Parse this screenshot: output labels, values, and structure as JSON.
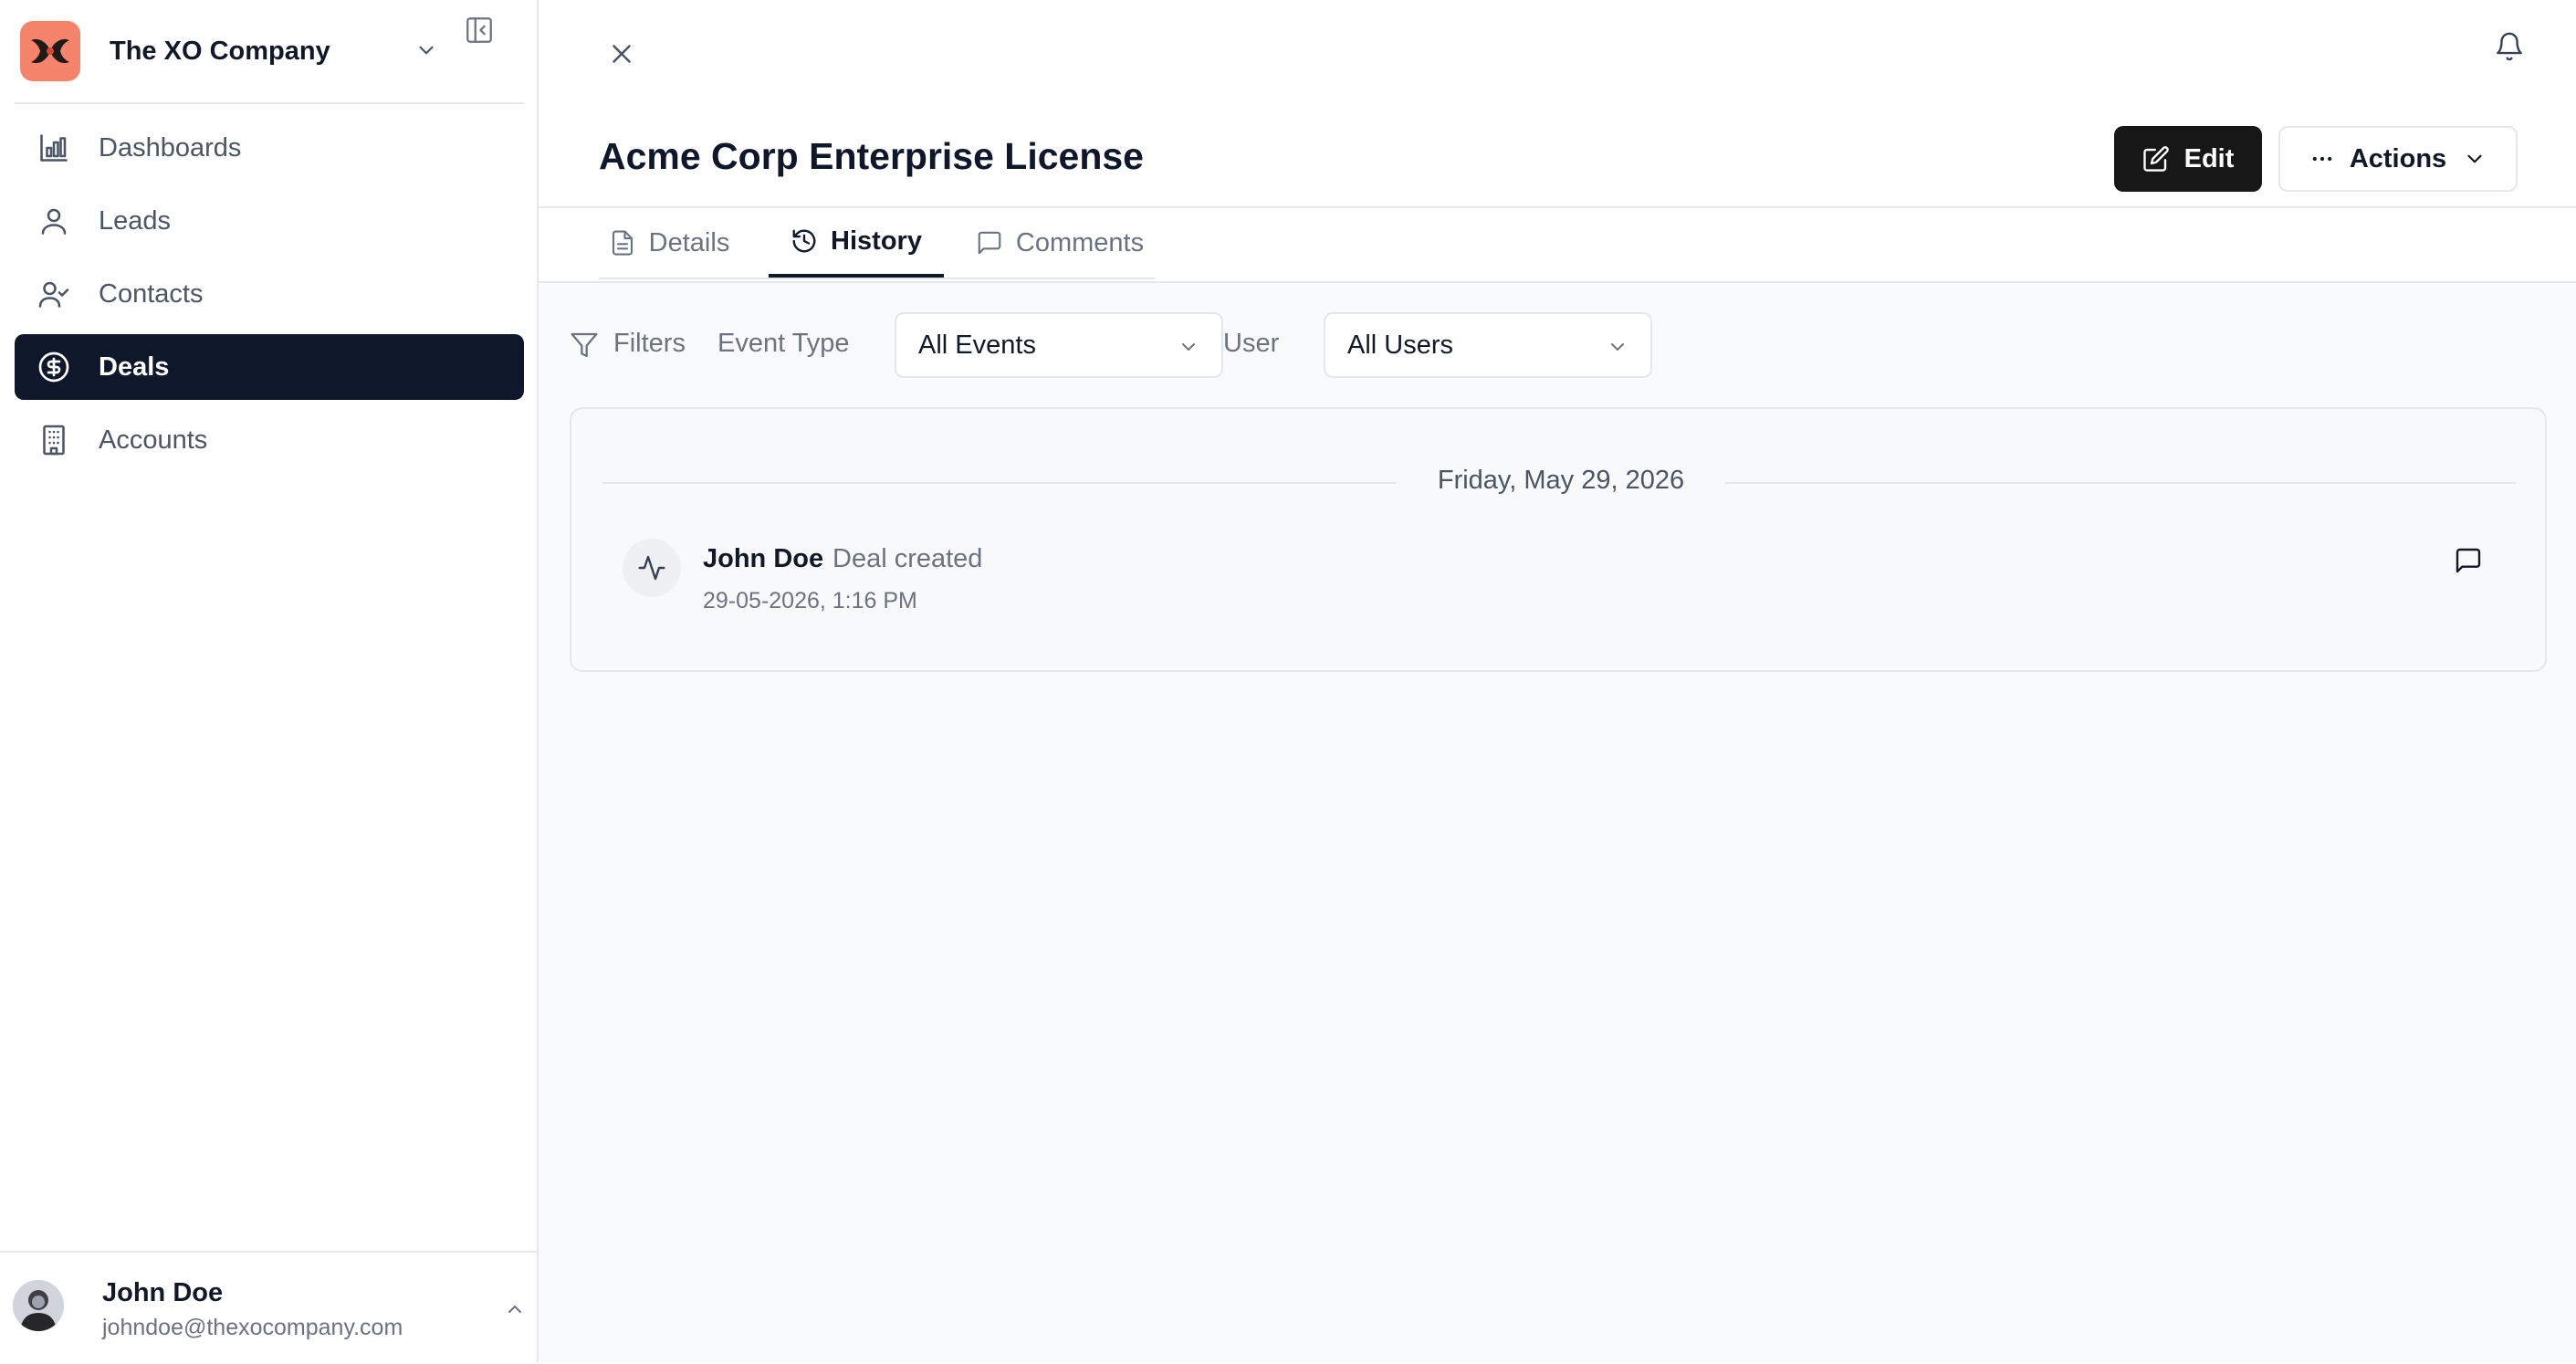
{
  "org": {
    "name": "The XO Company"
  },
  "sidebar": {
    "items": [
      {
        "label": "Dashboards",
        "icon": "bar-chart-icon",
        "active": false
      },
      {
        "label": "Leads",
        "icon": "user-icon",
        "active": false
      },
      {
        "label": "Contacts",
        "icon": "user-check-icon",
        "active": false
      },
      {
        "label": "Deals",
        "icon": "dollar-circle-icon",
        "active": true
      },
      {
        "label": "Accounts",
        "icon": "building-icon",
        "active": false
      }
    ]
  },
  "user": {
    "name": "John Doe",
    "email": "johndoe@thexocompany.com"
  },
  "header": {
    "title": "Acme Corp Enterprise License",
    "edit_label": "Edit",
    "actions_label": "Actions"
  },
  "tabs": [
    {
      "label": "Details",
      "icon": "file-text-icon",
      "active": false
    },
    {
      "label": "History",
      "icon": "history-icon",
      "active": true
    },
    {
      "label": "Comments",
      "icon": "message-square-icon",
      "active": false
    }
  ],
  "filters": {
    "label": "Filters",
    "event_type_label": "Event Type",
    "event_type_value": "All Events",
    "user_label": "User",
    "user_value": "All Users"
  },
  "history": {
    "date": "Friday, May 29, 2026",
    "events": [
      {
        "user": "John Doe",
        "action": "Deal created",
        "timestamp": "29-05-2026, 1:16 PM"
      }
    ]
  },
  "colors": {
    "accent": "#0f172a",
    "brand": "#f4846c",
    "background": "#f9fafb"
  }
}
